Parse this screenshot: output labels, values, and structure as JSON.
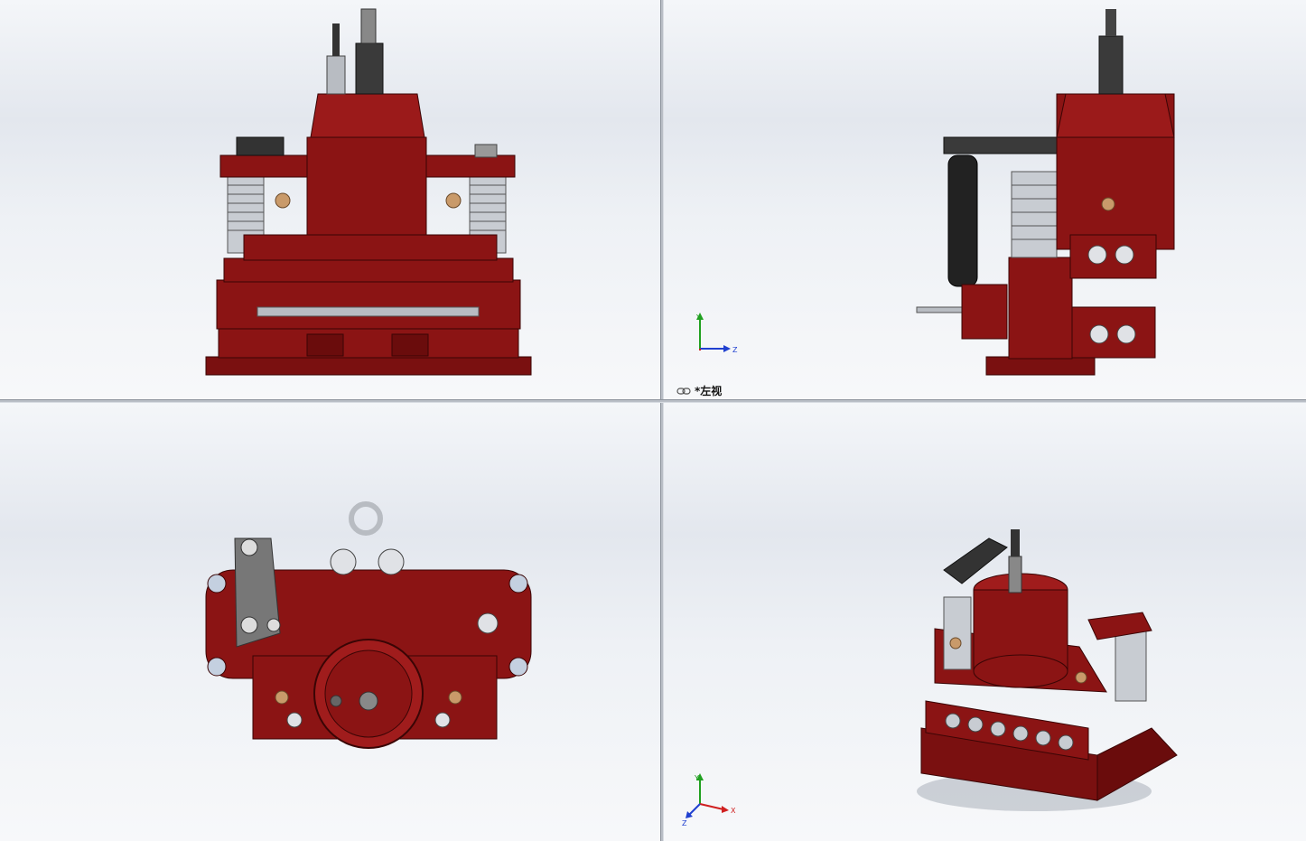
{
  "viewports": {
    "top_right": {
      "view_label": "*左视",
      "link_icon": "link-views-icon",
      "triad_axes": [
        "Y",
        "Z"
      ]
    },
    "bottom_right": {
      "triad_axes": [
        "Y",
        "X",
        "Z"
      ]
    }
  },
  "colors": {
    "body_red": "#8b1414",
    "dark_red": "#5c0808",
    "steel": "#b8bcc2",
    "dark_steel": "#3a3a3a",
    "brass": "#c99a6a",
    "axis_x": "#d02020",
    "axis_y": "#20a020",
    "axis_z": "#2040d0"
  }
}
